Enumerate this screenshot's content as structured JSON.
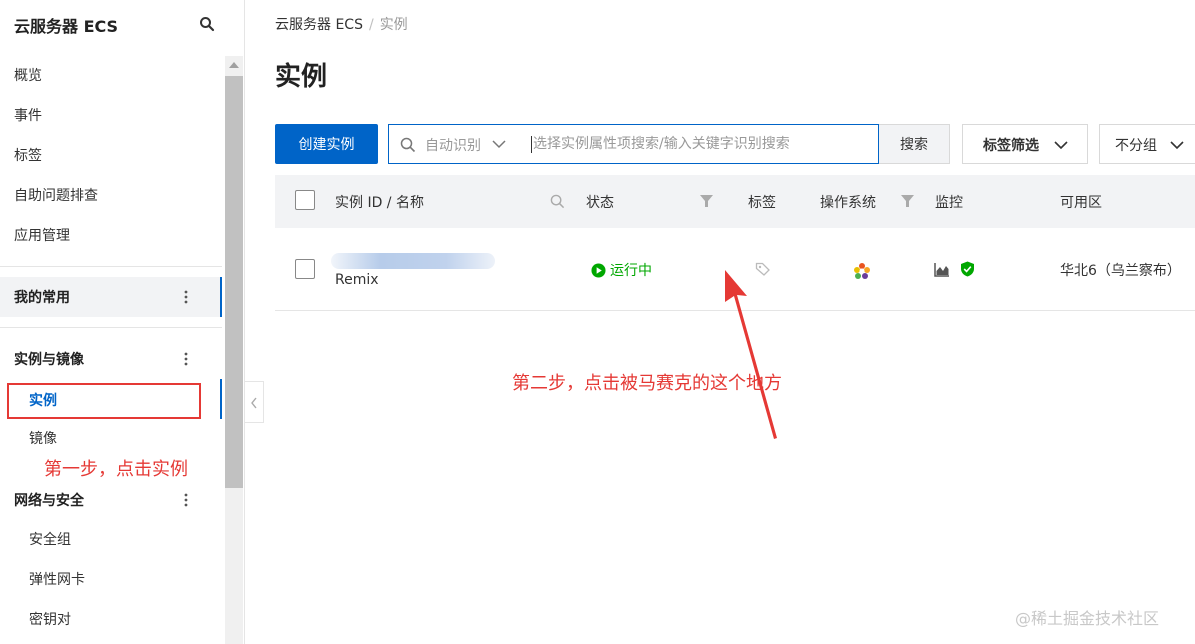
{
  "sidebar": {
    "title": "云服务器 ECS",
    "items": {
      "overview": "概览",
      "events": "事件",
      "tags": "标签",
      "troubleshoot": "自助问题排查",
      "app_mgmt": "应用管理"
    },
    "favorites_label": "我的常用",
    "group_instances": {
      "label": "实例与镜像",
      "items": [
        "实例",
        "镜像"
      ]
    },
    "group_network": {
      "label": "网络与安全",
      "items": [
        "安全组",
        "弹性网卡",
        "密钥对"
      ]
    }
  },
  "breadcrumb": {
    "root": "云服务器 ECS",
    "separator": "/",
    "current": "实例"
  },
  "page_title": "实例",
  "toolbar": {
    "create_label": "创建实例",
    "search_mode": "自动识别",
    "search_placeholder": "选择实例属性项搜索/输入关键字识别搜索",
    "search_button": "搜索",
    "tag_filter": "标签筛选",
    "group": "不分组"
  },
  "table": {
    "columns": {
      "id_name": "实例 ID / 名称",
      "status": "状态",
      "tags": "标签",
      "os": "操作系统",
      "monitor": "监控",
      "zone": "可用区"
    },
    "rows": [
      {
        "name": "Remix",
        "status": "运行中",
        "zone": "华北6（乌兰察布）"
      }
    ]
  },
  "annotations": {
    "step1": "第一步，点击实例",
    "step2": "第二步，点击被马赛克的这个地方"
  },
  "watermark": "@稀土掘金技术社区",
  "colors": {
    "primary": "#0064c8",
    "running": "#00a700",
    "annotation": "#e53935"
  }
}
